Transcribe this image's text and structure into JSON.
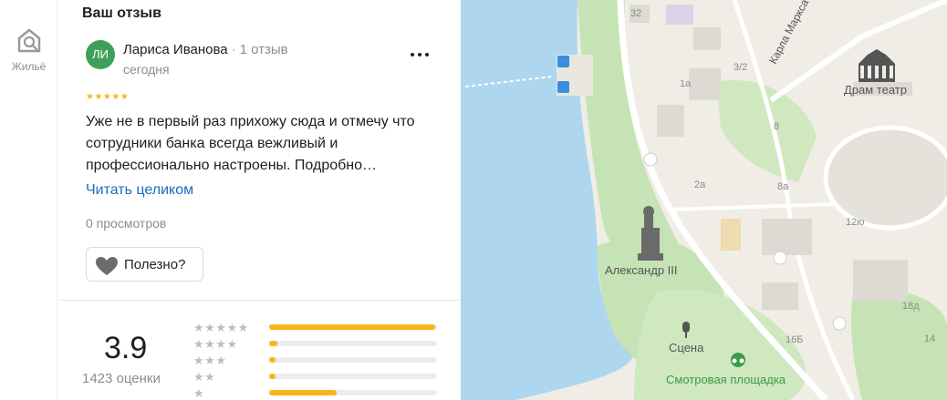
{
  "rail": {
    "item_label": "Жильё",
    "icon": "home-search-icon"
  },
  "review_section": {
    "title": "Ваш отзыв",
    "author": {
      "initials": "ЛИ",
      "name": "Лариса Иванова",
      "separator": "·",
      "reviews_count": "1 отзыв",
      "avatar_color": "#3f9f5a"
    },
    "date": "сегодня",
    "rating_stars": "★★★★★",
    "text": "Уже не в первый раз прихожу сюда и отмечу что сотрудники банка всегда вежливый и профессионально настроены. Подробно…",
    "read_more": "Читать целиком",
    "views": "0 просмотров",
    "useful_button": "Полезно?"
  },
  "rating_summary": {
    "score": "3.9",
    "count_label": "1423 оценки",
    "star_rows": [
      "★★★★★",
      "★★★★",
      "★★★",
      "★★",
      "★"
    ],
    "distribution": [
      0.99,
      0.05,
      0.04,
      0.04,
      0.4
    ]
  },
  "map": {
    "street": "Карла Маркса",
    "poi_theatre": "Драм театр",
    "poi_monument": "Александр III",
    "poi_stage": "Сцена",
    "poi_viewpoint": "Смотровая площадка",
    "house_numbers": [
      "32",
      "3/2",
      "1а",
      "8",
      "2а",
      "8а",
      "12ю",
      "16Б",
      "18д",
      "14"
    ],
    "water_color": "#aed6ef",
    "park_color": "#c5e3b4",
    "accent": "#f6b61b"
  }
}
